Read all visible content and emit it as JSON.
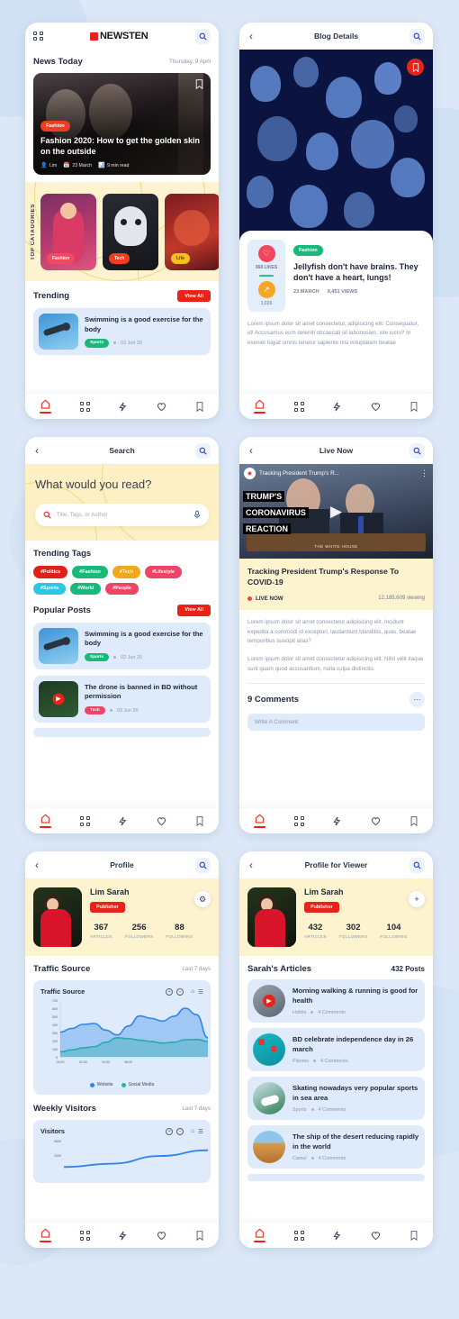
{
  "theme": {
    "bg": "#dce8f7",
    "red": "#e8241a",
    "yellow": "#fdf3cf",
    "blue_card": "#dfeafb",
    "green": "#2ec08c",
    "dark": "#1f2737"
  },
  "screens": {
    "home": {
      "brand": "NEWSTEN",
      "grid_icon": "grid-icon",
      "search_icon": "search-icon",
      "section_title": "News Today",
      "date": "Thursday, 9 April",
      "hero": {
        "chip": "Fashion",
        "title": "Fashion 2020: How to get the golden skin on the outside",
        "author": "Lim",
        "date": "23 March",
        "read": "9 min read",
        "bookmark_icon": "bookmark-icon"
      },
      "categories_label": "TOP CATAGORIES",
      "categories": [
        {
          "name": "Fashion",
          "color": "#ef4a5e"
        },
        {
          "name": "Tech",
          "color": "#ef3d21"
        },
        {
          "name": "Life",
          "color": "#f2c01f"
        }
      ],
      "trending_title": "Trending",
      "view_all": "View All",
      "trending": [
        {
          "title": "Swimming is a good exercise for the body",
          "tag": "Sports",
          "tag_color": "#18b97a",
          "date": "02 Jun 20"
        }
      ]
    },
    "blog": {
      "title": "Blog Details",
      "bookmark_icon": "bookmark-icon",
      "likes": "368 LIKES",
      "shares": "1,028",
      "chip": "Fashion",
      "headline": "Jellyfish don't have brains. They don't have a heart, lungs!",
      "date": "23 MARCH",
      "views": "9,451 VIEWS",
      "paragraph": "Lorem ipsum dolor sit amet consectetur, adipisicing elit. Consequatur, id! Accusamus eum deleniti obcaecati sit laboriosam, iste iusto? In eveniet fugiat omnis tenetur sapiente nisi voluptatem beatae"
    },
    "search": {
      "title": "Search",
      "question": "What would you read?",
      "placeholder": "Title, Tags, or Author",
      "mic_icon": "microphone-icon",
      "tags_title": "Trending Tags",
      "tags": [
        {
          "label": "#Politics",
          "color": "#e0211b"
        },
        {
          "label": "#Fashion",
          "color": "#18b97a"
        },
        {
          "label": "#Tech",
          "color": "#f0a81c"
        },
        {
          "label": "#Lifestyle",
          "color": "#ee4566"
        },
        {
          "label": "#Sports",
          "color": "#2dc6e8"
        },
        {
          "label": "#World",
          "color": "#18b97a"
        },
        {
          "label": "#People",
          "color": "#ee4566"
        }
      ],
      "popular_title": "Popular Posts",
      "view_all": "View All",
      "posts": [
        {
          "title": "Swimming is a good exercise for the body",
          "tag": "Sports",
          "tag_color": "#18b97a",
          "date": "02 Jun 20",
          "video": false
        },
        {
          "title": "The drone is banned in BD without permission",
          "tag": "Tech",
          "tag_color": "#ee4566",
          "date": "03 Jun 20",
          "video": true
        }
      ]
    },
    "live": {
      "title": "Live Now",
      "video_title": "Tracking President Trump's R...",
      "caption": [
        "TRUMP'S",
        "CORONAVIRUS",
        "REACTION"
      ],
      "podium": "THE WHITE HOUSE",
      "headline": "Tracking President Trump's Response To COVID-19",
      "live_label": "LIVE NOW",
      "viewing": "12,185,609 viewing",
      "paragraph1": "Lorem ipsum dolor sit amet consectetur adipisicing elit. Incidunt expedita a commodi id excepturi, laudantium blanditiis, quas, beatae temporibus suscipit alias?",
      "paragraph2": "Lorem ipsum dolor sit amet consectetur adipisicing elit. Nihil velit itaque sunt quam quod accusantium, nulla culpa distinctio.",
      "comments_count": "9 Comments",
      "comment_placeholder": "Write A Comment",
      "more_icon": "more-horizontal-icon"
    },
    "profile": {
      "title": "Profile",
      "name": "Lim Sarah",
      "badge": "Publisher",
      "settings_icon": "gear-icon",
      "stats": [
        {
          "value": "367",
          "label": "ARTICLES"
        },
        {
          "value": "256",
          "label": "FOLLOWERS"
        },
        {
          "value": "88",
          "label": "FOLLOWING"
        }
      ],
      "traffic_title": "Traffic Source",
      "traffic_range": "Last 7 days",
      "weekly_title": "Weekly Visitors",
      "weekly_range": "Last 7 days"
    },
    "viewer": {
      "title": "Profile for Viewer",
      "name": "Lim Sarah",
      "badge": "Publisher",
      "add_icon": "plus-icon",
      "stats": [
        {
          "value": "432",
          "label": "ARTICLES"
        },
        {
          "value": "302",
          "label": "FOLLOWERS"
        },
        {
          "value": "104",
          "label": "FOLLOWING"
        }
      ],
      "list_title": "Sarah's Articles",
      "posts_count": "432 Posts",
      "articles": [
        {
          "title": "Morning walking & running is good for health",
          "cat": "Habits",
          "comments": "4 Comments",
          "video": true
        },
        {
          "title": "BD celebrate independence day in 26 march",
          "cat": "Planets",
          "comments": "4 Comments",
          "video": false
        },
        {
          "title": "Skating nowadays very popular sports in sea area",
          "cat": "Sports",
          "comments": "4 Comments",
          "video": false
        },
        {
          "title": "The ship of the desert reducing rapidly in the world",
          "cat": "Camel",
          "comments": "4 Comments",
          "video": false
        }
      ]
    }
  },
  "bottom_nav": [
    {
      "name": "home-icon",
      "active": true
    },
    {
      "name": "grid-icon",
      "active": false
    },
    {
      "name": "lightning-icon",
      "active": false
    },
    {
      "name": "heart-icon",
      "active": false
    },
    {
      "name": "bookmark-icon",
      "active": false
    }
  ],
  "chart_data": [
    {
      "type": "area",
      "title": "Traffic Source",
      "xlabel": "",
      "ylabel": "",
      "ylim": [
        0,
        700
      ],
      "yticks": [
        0,
        100,
        200,
        300,
        400,
        500,
        600,
        700
      ],
      "xticks": [
        "00:00",
        "02:00",
        "04:00",
        "06:00"
      ],
      "grid": false,
      "legend": "bottom",
      "x": [
        0,
        0.5,
        1,
        1.5,
        2,
        2.5,
        3,
        3.5,
        4,
        4.5,
        5,
        5.5,
        6,
        6.5
      ],
      "series": [
        {
          "name": "Website",
          "color": "#2f86e8",
          "values": [
            305,
            350,
            400,
            410,
            330,
            270,
            380,
            505,
            475,
            440,
            500,
            600,
            520,
            235
          ]
        },
        {
          "name": "Social Media",
          "color": "#1fc08a",
          "values": [
            60,
            85,
            110,
            125,
            180,
            235,
            225,
            205,
            190,
            170,
            180,
            210,
            215,
            190
          ]
        }
      ]
    },
    {
      "type": "line",
      "title": "Visitors",
      "ylim": [
        3000,
        3600
      ],
      "yticks": [
        3300,
        3600
      ],
      "grid": false,
      "legend": "none",
      "series": [
        {
          "name": "Visitors",
          "color": "#2f86e8",
          "values": [
            3050,
            3120,
            3280,
            3400
          ]
        }
      ]
    }
  ]
}
